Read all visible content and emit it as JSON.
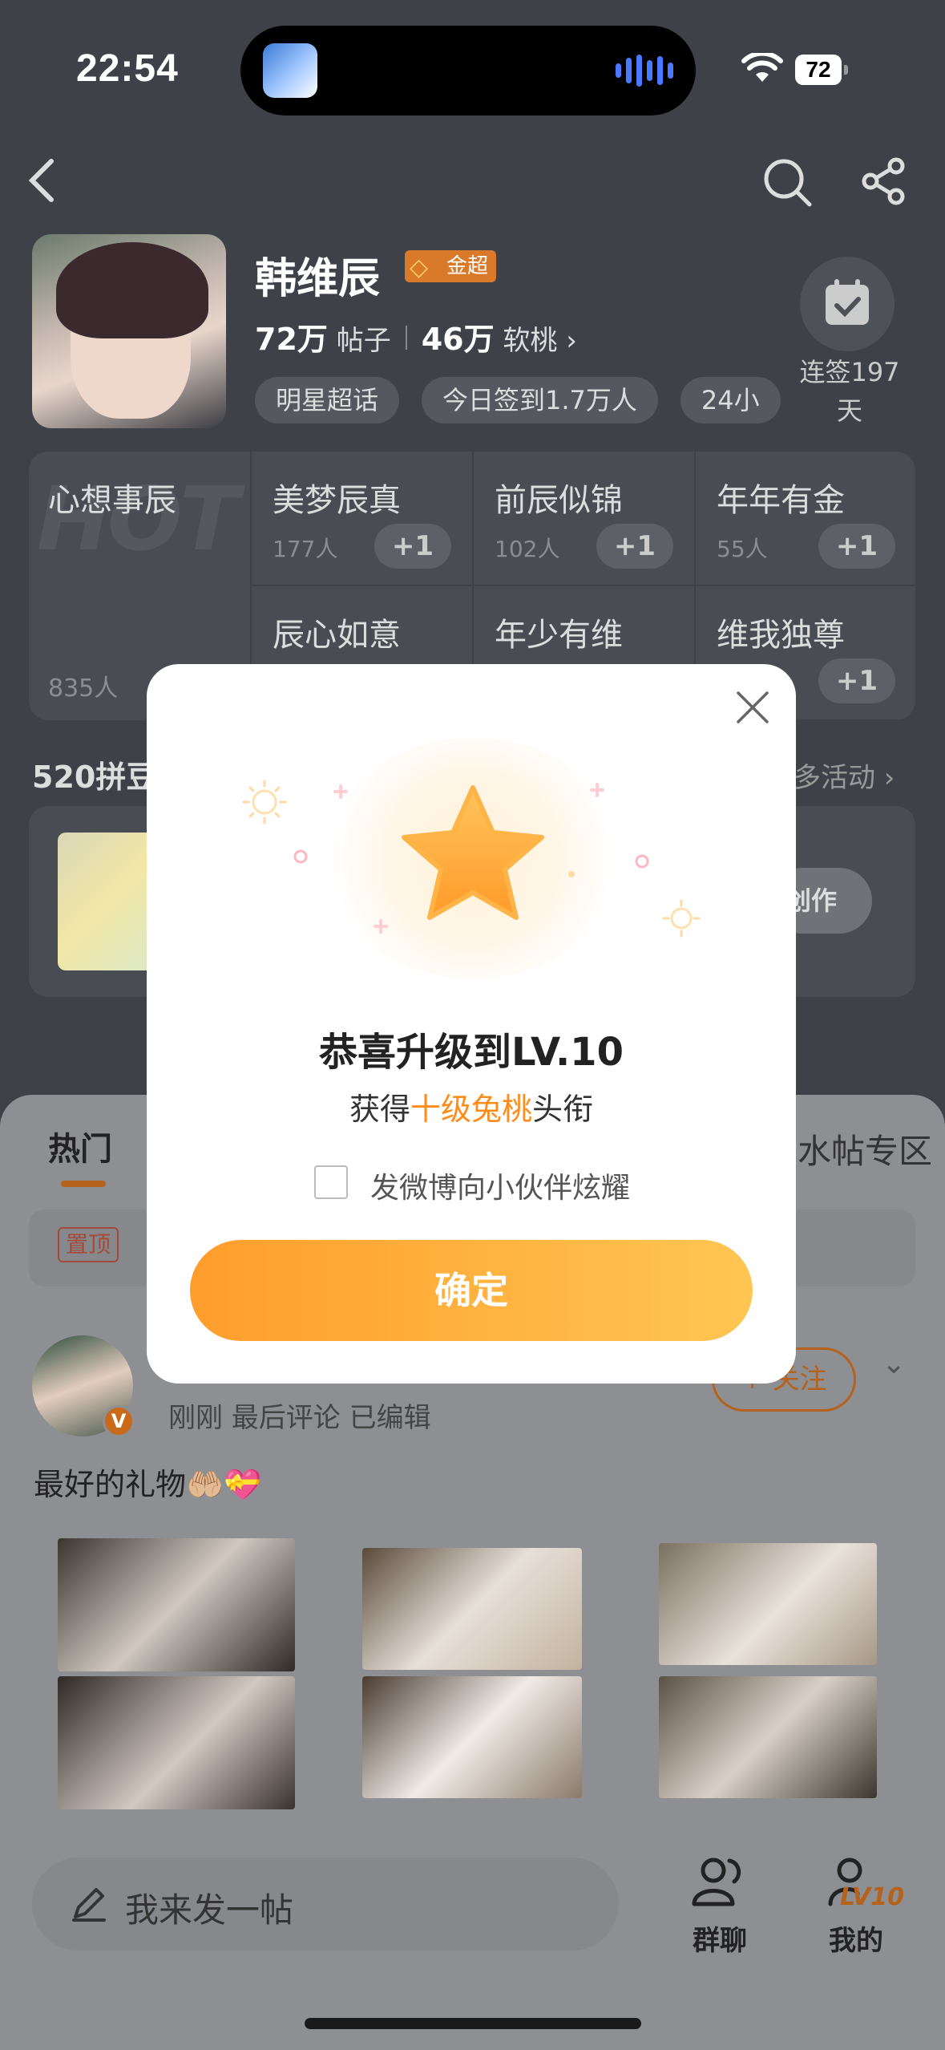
{
  "status": {
    "time": "22:54",
    "battery": "72"
  },
  "header": {
    "name": "韩维辰",
    "badge": "金超",
    "posts_count": "72万",
    "posts_label": "帖子",
    "peach_count": "46万",
    "peach_label": "软桃",
    "chips": [
      "明星超话",
      "今日签到1.7万人",
      "24小"
    ],
    "checkin_label": "连签197天"
  },
  "wishes": {
    "big": {
      "title": "心想事辰",
      "count": "835人"
    },
    "cells": [
      {
        "title": "美梦辰真",
        "count": "177人",
        "plus": "+1"
      },
      {
        "title": "前辰似锦",
        "count": "102人",
        "plus": "+1"
      },
      {
        "title": "年年有金",
        "count": "55人",
        "plus": "+1"
      },
      {
        "title": "辰心如意",
        "count": "",
        "plus": ""
      },
      {
        "title": "年少有维",
        "count": "",
        "plus": ""
      },
      {
        "title": "维我独尊",
        "count": "",
        "plus": "+1"
      }
    ]
  },
  "activity": {
    "title": "520拼豆",
    "more": "多活动",
    "button": "创作"
  },
  "tabs": {
    "hot": "热门",
    "water": "水帖专区"
  },
  "pinned": {
    "tag": "置顶"
  },
  "post": {
    "meta": "刚刚 最后评论  已编辑",
    "follow": "+ 关注",
    "caption": "最好的礼物🤲🏼💝"
  },
  "bottom": {
    "composer": "我来发一帖",
    "group_chat": "群聊",
    "mine": "我的",
    "level": "LV10"
  },
  "modal": {
    "title": "恭喜升级到LV.10",
    "sub_prefix": "获得",
    "sub_highlight": "十级兔桃",
    "sub_suffix": "头衔",
    "checkbox_label": "发微博向小伙伴炫耀",
    "confirm": "确定"
  },
  "colors": {
    "accent": "#ff9d2c",
    "highlight": "#ff8c1a",
    "overlay": "#3e4148"
  }
}
